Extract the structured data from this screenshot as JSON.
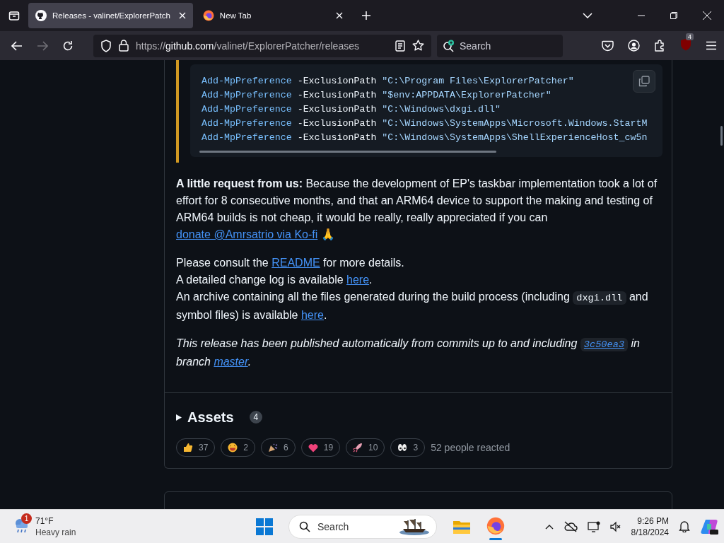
{
  "browser": {
    "tabs": [
      {
        "kind": "github",
        "title": "Releases - valinet/ExplorerPatch",
        "selected": true
      },
      {
        "kind": "firefox",
        "title": "New Tab",
        "selected": false
      }
    ],
    "url": {
      "scheme": "https://",
      "host": "github.com",
      "path": "/valinet/ExplorerPatcher/releases"
    },
    "search": {
      "placeholder": "Search"
    },
    "extension_badge": "4"
  },
  "release": {
    "code_lines": [
      {
        "cmd": "Add-MpPreference",
        "param": "-ExclusionPath",
        "arg": "\"C:\\Program Files\\ExplorerPatcher\""
      },
      {
        "cmd": "Add-MpPreference",
        "param": "-ExclusionPath",
        "arg": "\"$env:APPDATA\\ExplorerPatcher\""
      },
      {
        "cmd": "Add-MpPreference",
        "param": "-ExclusionPath",
        "arg": "\"C:\\Windows\\dxgi.dll\""
      },
      {
        "cmd": "Add-MpPreference",
        "param": "-ExclusionPath",
        "arg": "\"C:\\Windows\\SystemApps\\Microsoft.Windows.StartM"
      },
      {
        "cmd": "Add-MpPreference",
        "param": "-ExclusionPath",
        "arg": "\"C:\\Windows\\SystemApps\\ShellExperienceHost_cw5n"
      }
    ],
    "paragraphs": [
      {
        "kind": "plain",
        "lines": [
          [
            {
              "kind": "bold",
              "text": "A little request from us:"
            },
            {
              "kind": "text",
              "text": " Because the development of EP's taskbar implementation took a lot of effort for 8 consecutive months, and that an ARM64 device to support the making and testing of ARM64 builds is not cheap, it would be really, really appreciated if you can "
            },
            {
              "kind": "link",
              "text": "donate @Amrsatrio via Ko-fi"
            },
            {
              "kind": "emoji",
              "text": "🙏"
            }
          ]
        ]
      },
      {
        "kind": "plain",
        "lines": [
          [
            {
              "kind": "text",
              "text": "Please consult the "
            },
            {
              "kind": "link",
              "text": "README"
            },
            {
              "kind": "text",
              "text": " for more details."
            }
          ],
          [
            {
              "kind": "text",
              "text": "A detailed change log is available "
            },
            {
              "kind": "link",
              "text": "here"
            },
            {
              "kind": "text",
              "text": "."
            }
          ],
          [
            {
              "kind": "text",
              "text": "An archive containing all the files generated during the build process (including "
            },
            {
              "kind": "code",
              "text": "dxgi.dll"
            },
            {
              "kind": "text",
              "text": " and symbol files) is available "
            },
            {
              "kind": "link",
              "text": "here"
            },
            {
              "kind": "text",
              "text": "."
            }
          ]
        ]
      },
      {
        "kind": "note",
        "lines": [
          [
            {
              "kind": "text",
              "text": "This release has been published automatically from commits up to and including "
            },
            {
              "kind": "codelink",
              "text": "3c50ea3"
            },
            {
              "kind": "text",
              "text": " in branch "
            },
            {
              "kind": "link",
              "text": "master"
            },
            {
              "kind": "text",
              "text": "."
            }
          ]
        ]
      }
    ],
    "assets": {
      "label": "Assets",
      "count": "4",
      "expanded": false
    },
    "reactions": [
      {
        "kind": "thumbs",
        "count": "37"
      },
      {
        "kind": "laugh",
        "count": "2"
      },
      {
        "kind": "tada",
        "count": "6"
      },
      {
        "kind": "heart",
        "count": "19"
      },
      {
        "kind": "rocket",
        "count": "10"
      },
      {
        "kind": "eyes",
        "count": "3"
      }
    ],
    "reactions_summary": "52 people reacted"
  },
  "taskbar": {
    "weather": {
      "badge": "1",
      "temp": "71°F",
      "condition": "Heavy rain"
    },
    "search": {
      "placeholder": "Search"
    },
    "time": "9:26 PM",
    "date": "8/18/2024"
  }
}
